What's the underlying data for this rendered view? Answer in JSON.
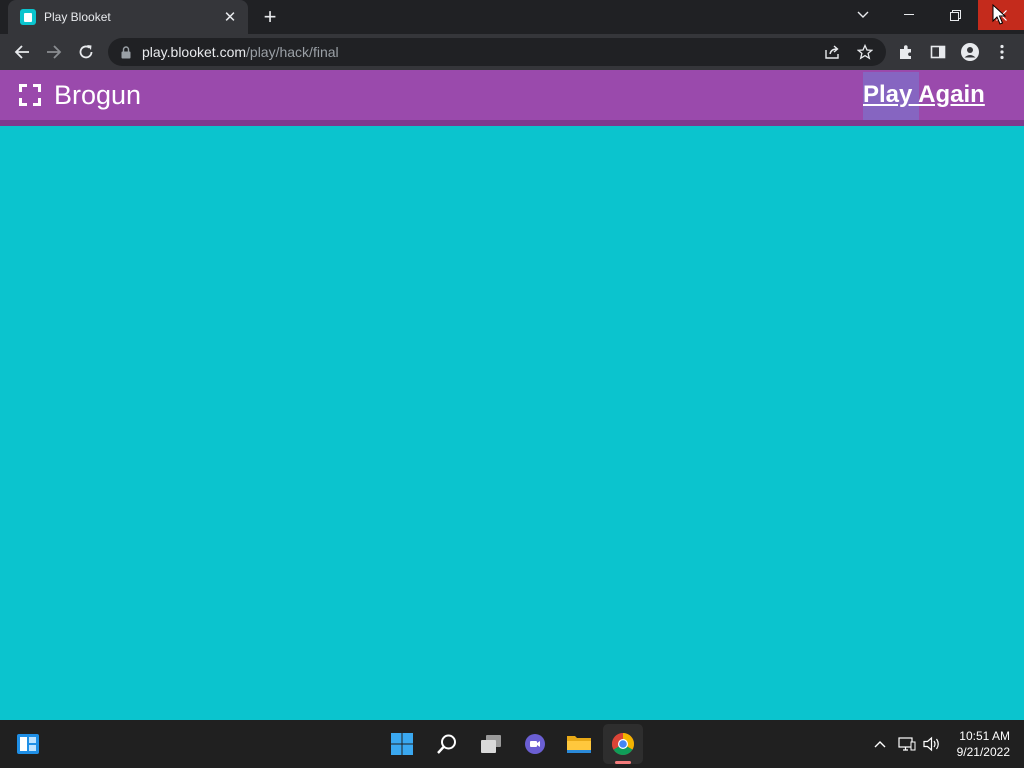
{
  "browser": {
    "tab_title": "Play Blooket",
    "tab_close": "✕",
    "new_tab": "+",
    "url_host": "play.blooket.com",
    "url_path": "/play/hack/final"
  },
  "page": {
    "brand": "Brogun",
    "play_again": "Play Again",
    "header_color": "#9a4aac",
    "background_color": "#0bc4ce"
  },
  "taskbar": {
    "time": "10:51 AM",
    "date": "9/21/2022"
  },
  "icons": [
    "widgets-icon",
    "windows-start-icon",
    "search-icon",
    "task-view-icon",
    "teams-chat-icon",
    "file-explorer-icon",
    "chrome-icon",
    "tray-chevron-icon",
    "network-icon",
    "volume-icon"
  ]
}
